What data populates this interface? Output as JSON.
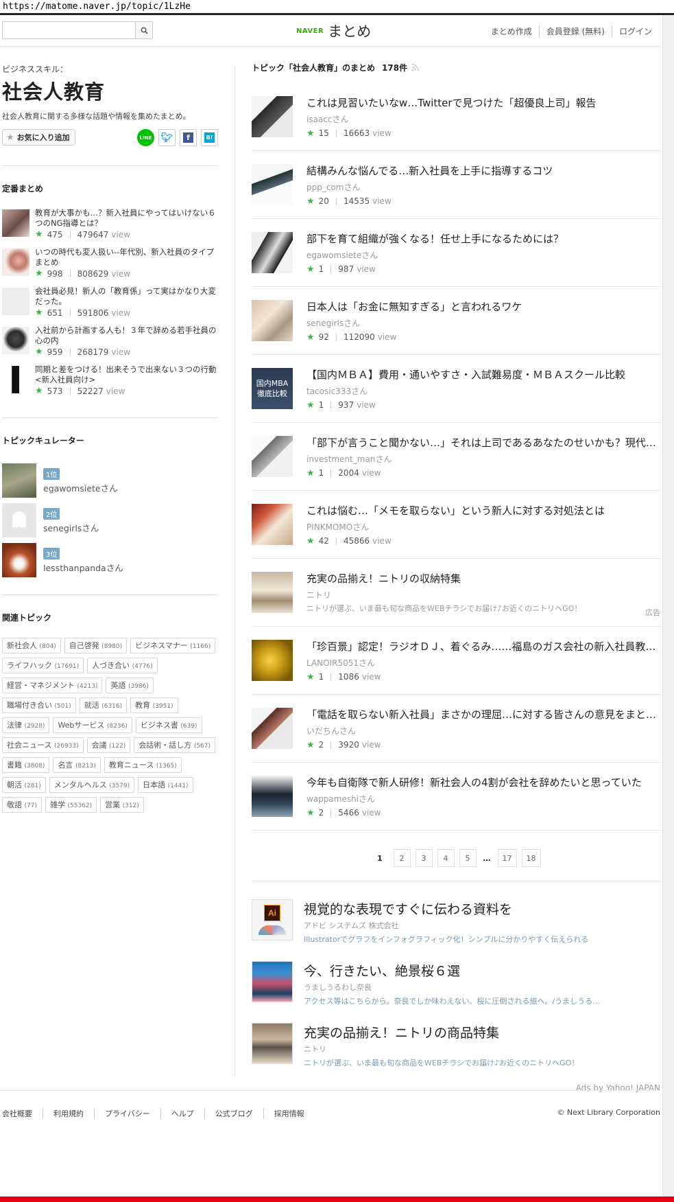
{
  "url": "https://matome.naver.jp/topic/1LzHe",
  "header": {
    "search_placeholder": "",
    "logo_naver": "NAVER",
    "logo_matome": "まとめ",
    "links": [
      "まとめ作成",
      "会員登録 (無料)",
      "ログイン"
    ]
  },
  "topic": {
    "category": "ビジネススキル：",
    "title": "社会人教育",
    "description": "社会人教育に関する多様な話題や情報を集めたまとめ。",
    "fav_label": "お気に入り追加",
    "share": [
      "LINE",
      "Twitter",
      "Facebook",
      "B!"
    ]
  },
  "teiban": {
    "heading": "定番まとめ",
    "items": [
      {
        "title": "教育が大事かも…？新入社員にやってはいけない６つのNG指導とは？",
        "stars": "475",
        "views": "479647",
        "view_label": "view"
      },
      {
        "title": "いつの時代も変人扱い--年代別、新入社員のタイプまとめ",
        "stars": "998",
        "views": "808629",
        "view_label": "view"
      },
      {
        "title": "会社員必見！新人の「教育係」って実はかなり大変だった。",
        "stars": "651",
        "views": "591806",
        "view_label": "view"
      },
      {
        "title": "入社前から計画する人も！３年で辞める若手社員の心の内",
        "stars": "959",
        "views": "268179",
        "view_label": "view"
      },
      {
        "title": "同期と差をつける！出来そうで出来ない３つの行動 <新入社員向け>",
        "stars": "573",
        "views": "52227",
        "view_label": "view"
      }
    ]
  },
  "curators": {
    "heading": "トピックキュレーター",
    "items": [
      {
        "rank": "1位",
        "name": "egawomsieteさん"
      },
      {
        "rank": "2位",
        "name": "senegirlsさん"
      },
      {
        "rank": "3位",
        "name": "lessthanpandaさん"
      }
    ]
  },
  "related": {
    "heading": "関連トピック",
    "tags": [
      {
        "name": "新社会人",
        "count": "(804)"
      },
      {
        "name": "自己啓発",
        "count": "(8980)"
      },
      {
        "name": "ビジネスマナー",
        "count": "(1166)"
      },
      {
        "name": "ライフハック",
        "count": "(17691)"
      },
      {
        "name": "人づき合い",
        "count": "(4776)"
      },
      {
        "name": "経営・マネジメント",
        "count": "(4213)"
      },
      {
        "name": "英語",
        "count": "(3986)"
      },
      {
        "name": "職場付き合い",
        "count": "(501)"
      },
      {
        "name": "就活",
        "count": "(6316)"
      },
      {
        "name": "教育",
        "count": "(3951)"
      },
      {
        "name": "法律",
        "count": "(2928)"
      },
      {
        "name": "Webサービス",
        "count": "(8236)"
      },
      {
        "name": "ビジネス書",
        "count": "(639)"
      },
      {
        "name": "社会ニュース",
        "count": "(26933)"
      },
      {
        "name": "会議",
        "count": "(122)"
      },
      {
        "name": "会話術・話し方",
        "count": "(567)"
      },
      {
        "name": "書籍",
        "count": "(3808)"
      },
      {
        "name": "名言",
        "count": "(8213)"
      },
      {
        "name": "教育ニュース",
        "count": "(1365)"
      },
      {
        "name": "朝活",
        "count": "(281)"
      },
      {
        "name": "メンタルヘルス",
        "count": "(3579)"
      },
      {
        "name": "日本語",
        "count": "(1441)"
      },
      {
        "name": "敬語",
        "count": "(77)"
      },
      {
        "name": "雑学",
        "count": "(55362)"
      },
      {
        "name": "営業",
        "count": "(312)"
      }
    ]
  },
  "main": {
    "heading": "トピック「社会人教育」のまとめ",
    "count": "178件",
    "articles": [
      {
        "title": "これは見習いたいなw…Twitterで見つけた「超優良上司」報告",
        "author": "isaaccさん",
        "stars": "15",
        "views": "16663",
        "view_label": "view"
      },
      {
        "title": "結構みんな悩んでる…新入社員を上手に指導するコツ",
        "author": "ppp_comさん",
        "stars": "20",
        "views": "14535",
        "view_label": "view"
      },
      {
        "title": "部下を育て組織が強くなる！任せ上手になるためには？",
        "author": "egawomsieteさん",
        "stars": "1",
        "views": "987",
        "view_label": "view"
      },
      {
        "title": "日本人は「お金に無知すぎる」と言われるワケ",
        "author": "senegirlsさん",
        "stars": "92",
        "views": "112090",
        "view_label": "view"
      },
      {
        "title": "【国内ＭＢＡ】費用・通いやすさ・入試難易度・ＭＢＡスクール比較",
        "author": "tacosic333さん",
        "stars": "1",
        "views": "937",
        "view_label": "view",
        "thumb_text": "国内MBA徹底比較"
      },
      {
        "title": "「部下が言うこと聞かない…」それは上司であるあなたのせいかも？現代の若者の特徴",
        "author": "investment_manさん",
        "stars": "1",
        "views": "2004",
        "view_label": "view"
      },
      {
        "title": "これは悩む…「メモを取らない」という新人に対する対処法とは",
        "author": "PINKMOMOさん",
        "stars": "42",
        "views": "45866",
        "view_label": "view"
      },
      {
        "title": "充実の品揃え！ニトリの収納特集",
        "author": "ニトリ",
        "ad_desc": "ニトリが選ぶ、いま最も旬な商品をWEBチラシでお届け♪お近くのニトリへGO！",
        "ad_badge": "広告",
        "is_ad": true
      },
      {
        "title": "「珍百景」認定！ラジオＤＪ、着ぐるみ……福島のガス会社の新入社員教育がすごい",
        "author": "LANOIR5051さん",
        "stars": "1",
        "views": "1086",
        "view_label": "view"
      },
      {
        "title": "「電話を取らない新入社員」まさかの理屈…に対する皆さんの意見をまとめました",
        "author": "いだちんさん",
        "stars": "2",
        "views": "3920",
        "view_label": "view"
      },
      {
        "title": "今年も自衛隊で新人研修！新社会人の4割が会社を辞めたいと思っていた",
        "author": "wappameshiさん",
        "stars": "2",
        "views": "5466",
        "view_label": "view"
      }
    ],
    "pager": [
      "1",
      "2",
      "3",
      "4",
      "5",
      "…",
      "17",
      "18"
    ]
  },
  "ads": {
    "items": [
      {
        "title": "視覚的な表現ですぐに伝わる資料を",
        "sponsor": "アドビ システムズ 株式会社",
        "desc": "Illustratorでグラフをインフォグラフィック化！シンプルに分かりやすく伝えられる"
      },
      {
        "title": "今、行きたい、絶景桜６選",
        "sponsor": "うましうるわし奈良",
        "desc": "アクセス等はこちらから。奈良でしか味わえない、桜に圧倒される旅へ。/うましうるわし奈良"
      },
      {
        "title": "充実の品揃え！ニトリの商品特集",
        "sponsor": "ニトリ",
        "desc": "ニトリが選ぶ、いま最も旬な商品をWEBチラシでお届け♪お近くのニトリへGO！"
      }
    ],
    "by": "Ads by Yahoo! JAPAN"
  },
  "footer": {
    "links": [
      "会社概要",
      "利用規約",
      "プライバシー",
      "ヘルプ",
      "公式ブログ",
      "採用情報"
    ],
    "copyright": "© Next Library Corporation"
  },
  "colors": {
    "star": "#3cb44b",
    "naver_green": "#2db400",
    "rank_badge": "#7aa8c8",
    "redbar": "#e60012"
  }
}
